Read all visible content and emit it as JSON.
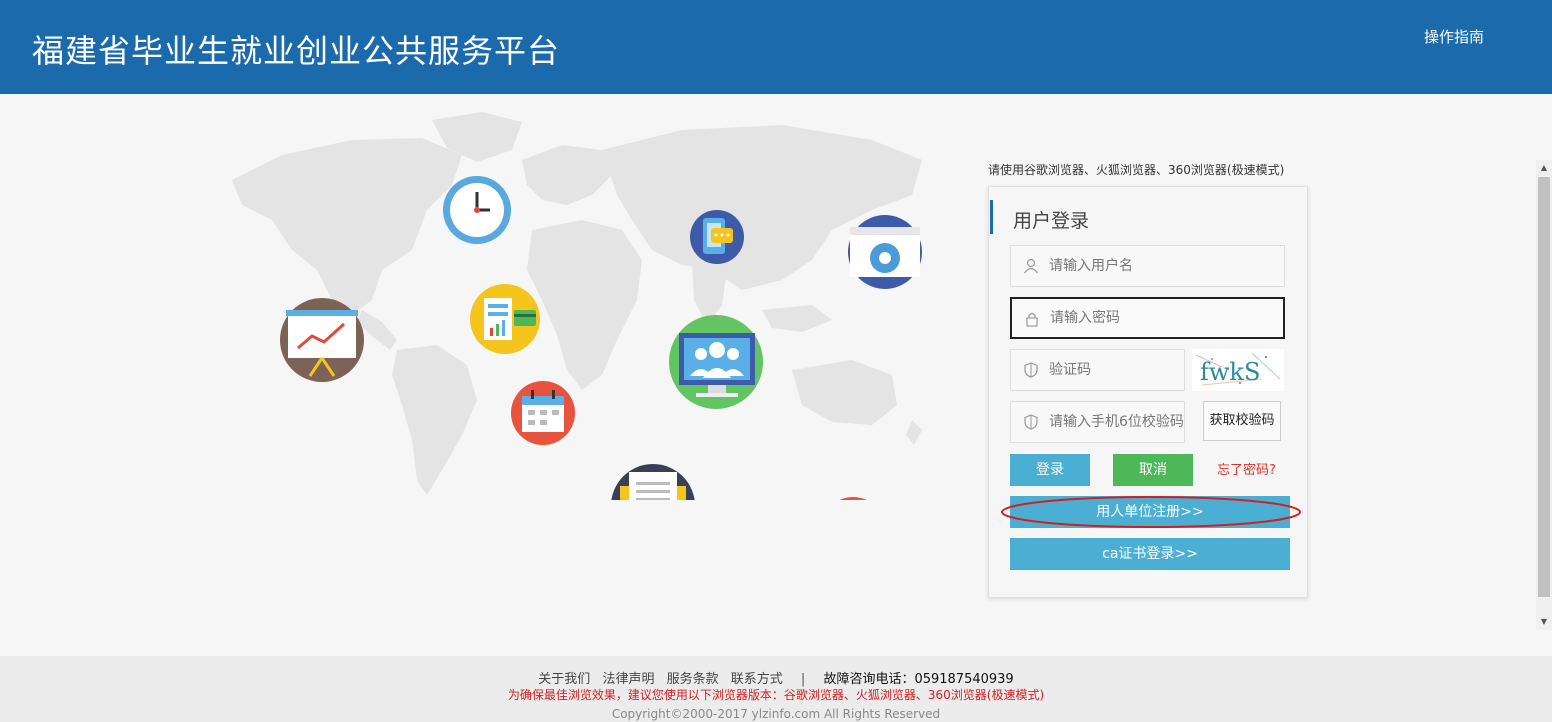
{
  "header": {
    "title": "福建省毕业生就业创业公共服务平台",
    "guide_link": "操作指南"
  },
  "browser_tip": "请使用谷歌浏览器、火狐浏览器、360浏览器(极速模式)",
  "login": {
    "title": "用户登录",
    "username_placeholder": "请输入用户名",
    "password_placeholder": "请输入密码",
    "captcha_placeholder": "验证码",
    "captcha_text": "fwkS",
    "sms_placeholder": "请输入手机6位校验码",
    "sms_button": "获取校验码",
    "login_button": "登录",
    "cancel_button": "取消",
    "forgot_link": "忘了密码?",
    "register_button": "用人单位注册>>",
    "ca_button": "ca证书登录>>"
  },
  "footer": {
    "links": [
      "关于我们",
      "法律声明",
      "服务条款",
      "联系方式"
    ],
    "phone": "故障咨询电话：059187540939",
    "notice": "为确保最佳浏览效果，建议您使用以下浏览器版本：谷歌浏览器、火狐浏览器、360浏览器(极速模式)",
    "copyright": "Copyright©2000-2017 ylzinfo.com All Rights Reserved"
  },
  "colors": {
    "header_bg": "#1b6aab",
    "primary_button": "#4bafd4",
    "cancel_button": "#4cb858",
    "link_red": "#e0322b"
  },
  "icons": [
    "clock-icon",
    "chat-phone-icon",
    "settings-window-icon",
    "presentation-chart-icon",
    "report-chart-icon",
    "users-monitor-icon",
    "calendar-icon",
    "envelope-icon",
    "calculator-icon",
    "chip-icon"
  ]
}
